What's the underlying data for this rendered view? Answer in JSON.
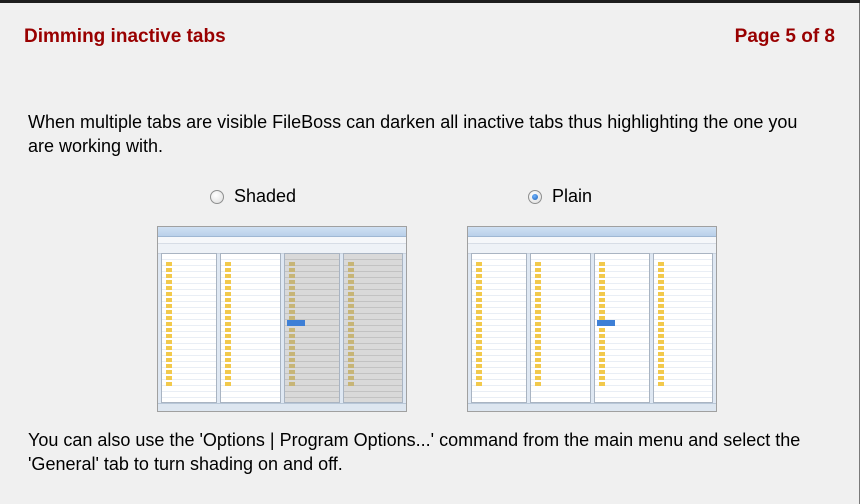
{
  "header": {
    "title": "Dimming inactive tabs",
    "page_indicator": "Page 5 of 8"
  },
  "description": "When multiple tabs are visible FileBoss can darken all inactive tabs thus highlighting the one you are working with.",
  "options": [
    {
      "label": "Shaded",
      "checked": false
    },
    {
      "label": "Plain",
      "checked": true
    }
  ],
  "footer": "You can also use the 'Options | Program Options...' command from the main menu and select the 'General' tab to turn shading on and off.",
  "colors": {
    "title": "#990000",
    "background": "#f0f0f0",
    "radio_selected": "#1a5fb4"
  }
}
